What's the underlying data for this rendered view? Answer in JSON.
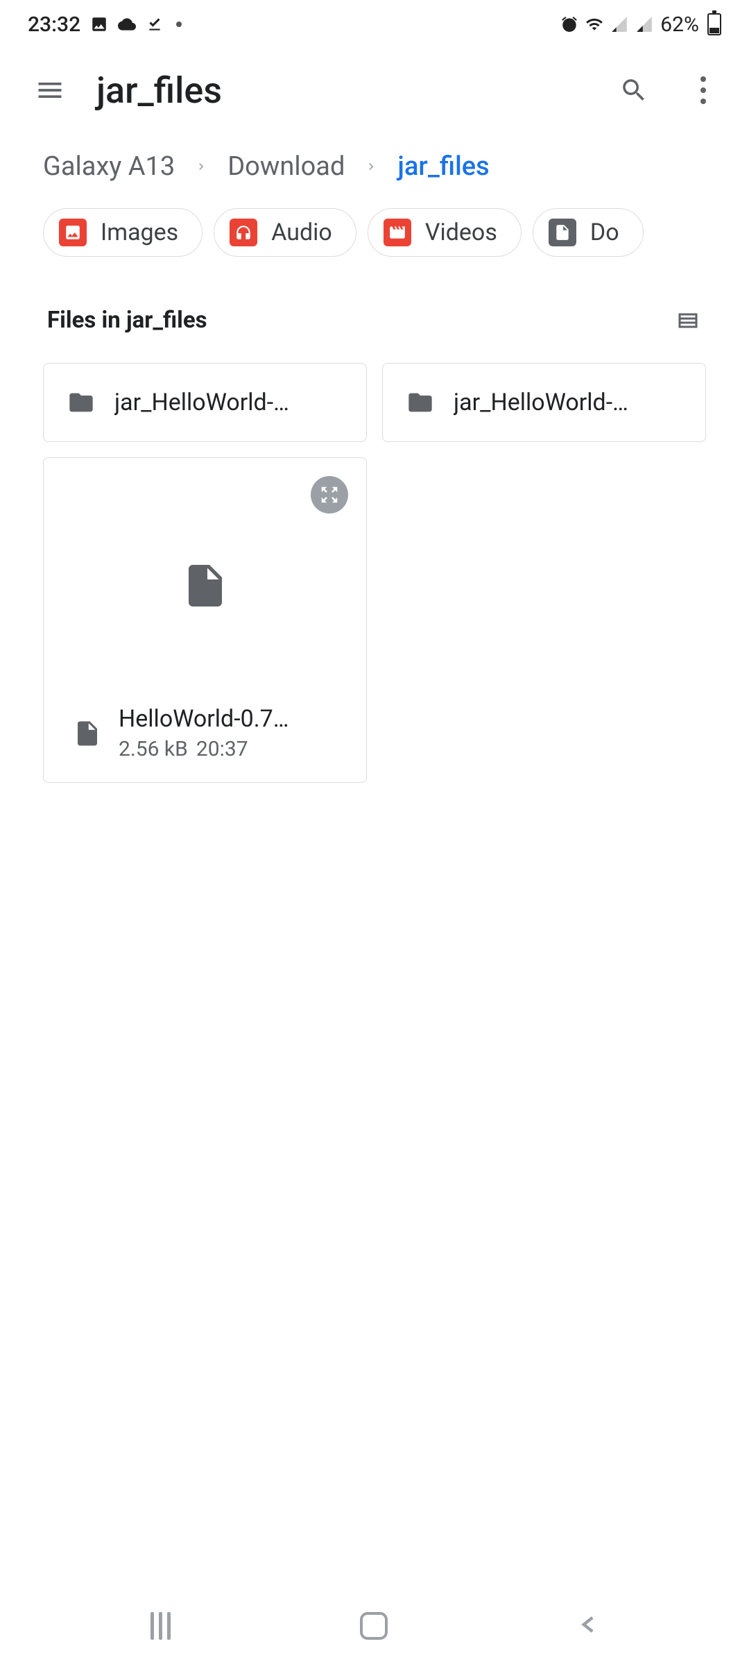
{
  "status": {
    "time": "23:32",
    "battery": "62%"
  },
  "appbar": {
    "title": "jar_files"
  },
  "breadcrumb": {
    "items": [
      {
        "label": "Galaxy A13",
        "active": false
      },
      {
        "label": "Download",
        "active": false
      },
      {
        "label": "jar_files",
        "active": true
      }
    ]
  },
  "chips": [
    {
      "label": "Images",
      "icon": "image"
    },
    {
      "label": "Audio",
      "icon": "audio"
    },
    {
      "label": "Videos",
      "icon": "video"
    },
    {
      "label": "Do",
      "icon": "doc"
    }
  ],
  "section_title": "Files in jar_files",
  "folders": [
    {
      "name": "jar_HelloWorld-…"
    },
    {
      "name": "jar_HelloWorld-…"
    }
  ],
  "files": [
    {
      "name": "HelloWorld-0.7…",
      "size": "2.56 kB",
      "time": "20:37"
    }
  ]
}
